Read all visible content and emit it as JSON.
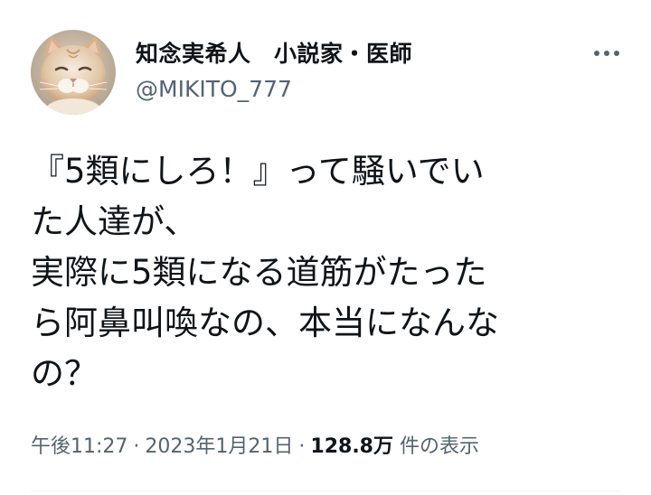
{
  "author": {
    "display_name": "知念実希人　小説家・医師",
    "handle": "@MIKITO_777",
    "avatar": "cat-photo"
  },
  "tweet": {
    "lines": [
      "『5類にしろ！』って騒いでい",
      "た人達が、",
      "実際に5類になる道筋がたった",
      "ら阿鼻叫喚なの、本当になんな",
      "の？"
    ]
  },
  "meta": {
    "time": "午後11:27",
    "separator": "·",
    "date": "2023年1月21日",
    "views_count": "128.8万",
    "views_label": "件の表示"
  },
  "icons": {
    "more": "more-horizontal-icon"
  },
  "colors": {
    "text_primary": "#0f1419",
    "text_secondary": "#536471",
    "divider": "#eff3f4"
  }
}
